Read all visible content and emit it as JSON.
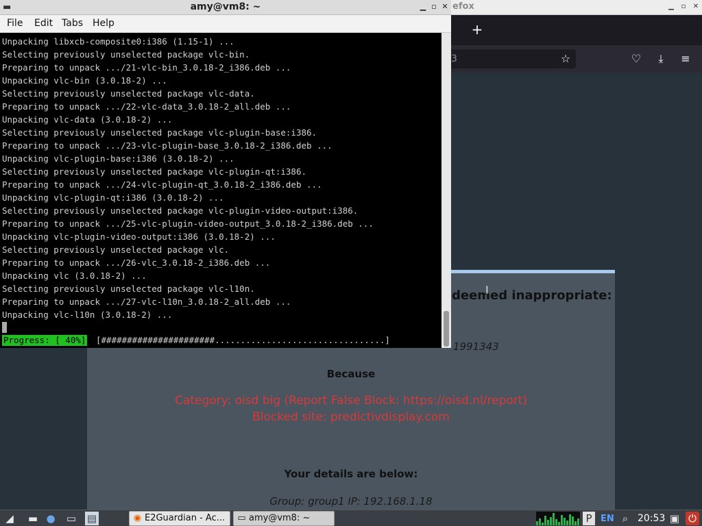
{
  "firefox": {
    "title": "efox",
    "url_fragment": "3",
    "page": {
      "heading": "deemed inappropriate:",
      "blocked_url": "1991343",
      "because": "Because",
      "category": "Category: oisd big (Report False Block: https://oisd.nl/report)",
      "blocked_site": "Blocked site: predictivdisplay.com",
      "details_heading": "Your details are below:",
      "group_ip": "Group: group1   IP: 192.168.1.18"
    }
  },
  "terminal": {
    "title": "amy@vm8: ~",
    "menu": [
      "File",
      "Edit",
      "Tabs",
      "Help"
    ],
    "lines": [
      "Unpacking libxcb-composite0:i386 (1.15-1) ...",
      "Selecting previously unselected package vlc-bin.",
      "Preparing to unpack .../21-vlc-bin_3.0.18-2_i386.deb ...",
      "Unpacking vlc-bin (3.0.18-2) ...",
      "Selecting previously unselected package vlc-data.",
      "Preparing to unpack .../22-vlc-data_3.0.18-2_all.deb ...",
      "Unpacking vlc-data (3.0.18-2) ...",
      "Selecting previously unselected package vlc-plugin-base:i386.",
      "Preparing to unpack .../23-vlc-plugin-base_3.0.18-2_i386.deb ...",
      "Unpacking vlc-plugin-base:i386 (3.0.18-2) ...",
      "Selecting previously unselected package vlc-plugin-qt:i386.",
      "Preparing to unpack .../24-vlc-plugin-qt_3.0.18-2_i386.deb ...",
      "Unpacking vlc-plugin-qt:i386 (3.0.18-2) ...",
      "Selecting previously unselected package vlc-plugin-video-output:i386.",
      "Preparing to unpack .../25-vlc-plugin-video-output_3.0.18-2_i386.deb ...",
      "Unpacking vlc-plugin-video-output:i386 (3.0.18-2) ...",
      "Selecting previously unselected package vlc.",
      "Preparing to unpack .../26-vlc_3.0.18-2_i386.deb ...",
      "Unpacking vlc (3.0.18-2) ...",
      "Selecting previously unselected package vlc-l10n.",
      "Preparing to unpack .../27-vlc-l10n_3.0.18-2_all.deb ...",
      "Unpacking vlc-l10n (3.0.18-2) ..."
    ],
    "progress_label": "Progress: [ 40%]",
    "progress_bar": "[######################.................................]",
    "progress_fraction": 0.4
  },
  "taskbar": {
    "tasks": [
      {
        "label": "E2Guardian - Ac...",
        "icon": "firefox-icon"
      },
      {
        "label": "amy@vm8: ~",
        "icon": "terminal-icon"
      }
    ],
    "language": "EN",
    "clock": "20:53"
  },
  "colors": {
    "progress_green": "#20c020",
    "blocked_red": "#d63a3a",
    "card_accent": "#a9c9ec"
  }
}
